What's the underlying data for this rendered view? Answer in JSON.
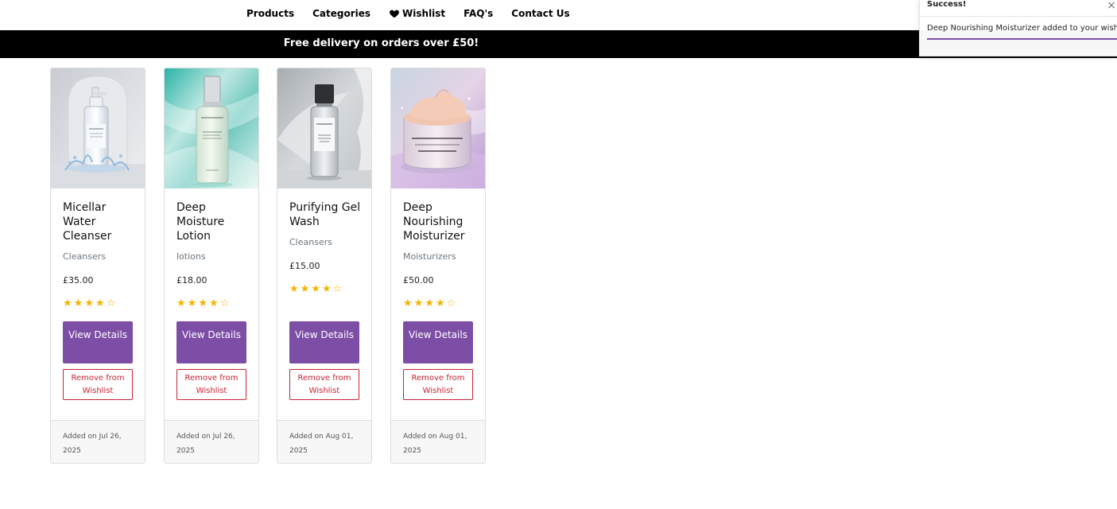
{
  "nav": {
    "items": [
      {
        "label": "Products"
      },
      {
        "label": "Categories"
      },
      {
        "label": "Wishlist",
        "icon": "heart-icon"
      },
      {
        "label": "FAQ's"
      },
      {
        "label": "Contact Us"
      }
    ]
  },
  "promo": {
    "text": "Free delivery on orders over £50!"
  },
  "toast": {
    "title": "Success!",
    "close": "×",
    "message": "Deep Nourishing Moisturizer added to your wishlist"
  },
  "colors": {
    "brand": "#7d4ea6",
    "danger": "#c82333",
    "star": "#f5b301",
    "promo_bg": "#000000"
  },
  "buttons": {
    "view": "View Details",
    "remove": "Remove from Wishlist"
  },
  "products": [
    {
      "title": "Micellar Water Cleanser",
      "category": "Cleansers",
      "price": "£35.00",
      "rating": 4,
      "rating_max": 5,
      "added": "Added on Jul 26, 2025",
      "image": "micellar-bottle"
    },
    {
      "title": "Deep Moisture Lotion",
      "category": "lotions",
      "price": "£18.00",
      "rating": 4,
      "rating_max": 5,
      "added": "Added on Jul 26, 2025",
      "image": "lotion-bottle"
    },
    {
      "title": "Purifying Gel Wash",
      "category": "Cleansers",
      "price": "£15.00",
      "rating": 4,
      "rating_max": 5,
      "added": "Added on Aug 01, 2025",
      "image": "gel-bottle"
    },
    {
      "title": "Deep Nourishing Moisturizer",
      "category": "Moisturizers",
      "price": "£50.00",
      "rating": 4,
      "rating_max": 5,
      "added": "Added on Aug 01, 2025",
      "image": "cream-jar"
    }
  ]
}
